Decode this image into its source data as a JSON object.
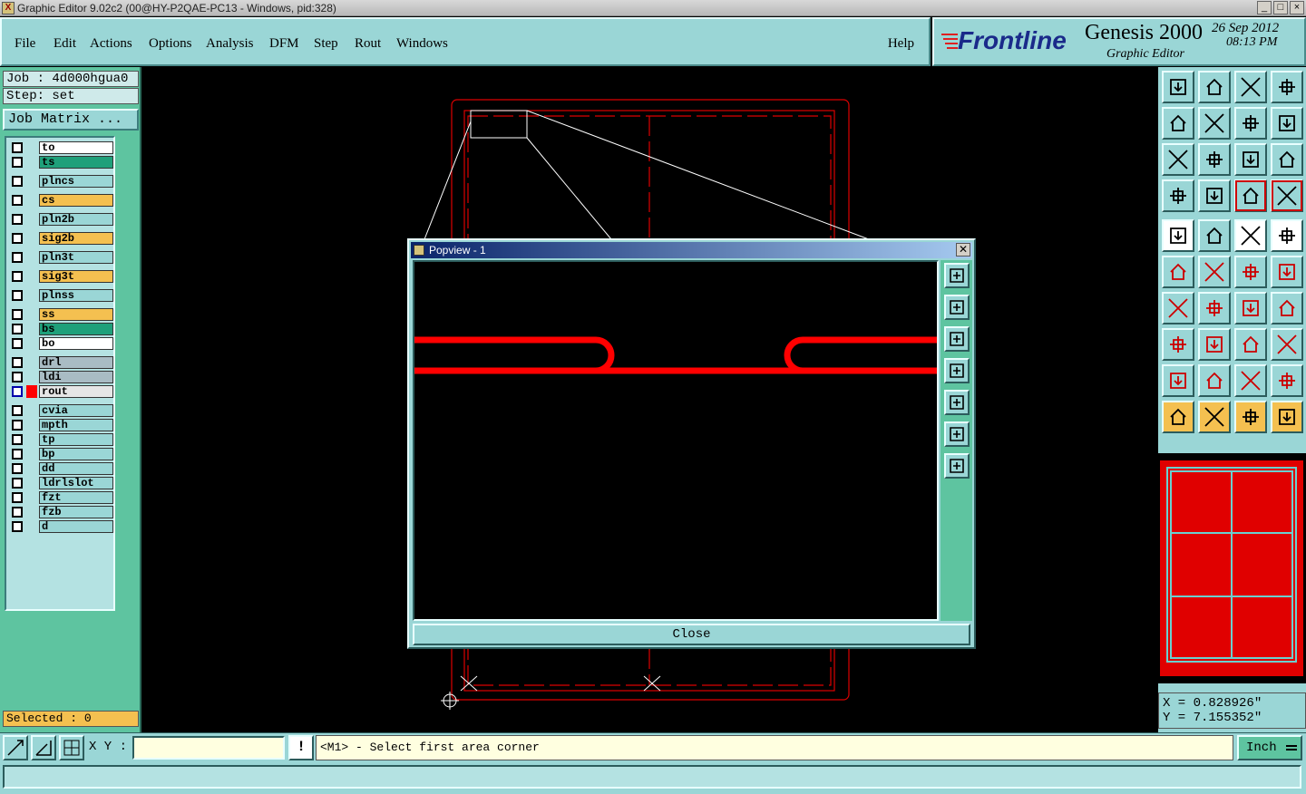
{
  "window": {
    "title": "Graphic Editor 9.02c2 (00@HY-P2QAE-PC13 - Windows, pid:328)",
    "app_icon_glyph": "X"
  },
  "menu": {
    "items": [
      {
        "label": "File",
        "name": "menu-file"
      },
      {
        "label": "Edit",
        "name": "menu-edit"
      },
      {
        "label": "Actions",
        "name": "menu-actions"
      },
      {
        "label": "Options",
        "name": "menu-options"
      },
      {
        "label": "Analysis",
        "name": "menu-analysis"
      },
      {
        "label": "DFM",
        "name": "menu-dfm"
      },
      {
        "label": "Step",
        "name": "menu-step"
      },
      {
        "label": "Rout",
        "name": "menu-rout"
      },
      {
        "label": "Windows",
        "name": "menu-windows"
      }
    ],
    "help_label": "Help"
  },
  "brand": {
    "logo": "Frontline",
    "product": "Genesis 2000",
    "subtitle": "Graphic Editor",
    "date": "26 Sep 2012",
    "time": "08:13 PM"
  },
  "job": {
    "job_label": "Job : 4d000hgua0",
    "step_label": "Step: set",
    "matrix_button": "Job Matrix ..."
  },
  "layers": [
    {
      "name": "to",
      "color": "#ffffff"
    },
    {
      "name": "ts",
      "color": "#1fa07a"
    },
    {
      "name": "plncs",
      "color": "#9ad6d6"
    },
    {
      "name": "cs",
      "color": "#f4c050"
    },
    {
      "name": "pln2b",
      "color": "#9ad6d6"
    },
    {
      "name": "sig2b",
      "color": "#f4c050"
    },
    {
      "name": "pln3t",
      "color": "#9ad6d6"
    },
    {
      "name": "sig3t",
      "color": "#f4c050"
    },
    {
      "name": "plnss",
      "color": "#9ad6d6"
    },
    {
      "name": "ss",
      "color": "#f4c050"
    },
    {
      "name": "bs",
      "color": "#1fa07a"
    },
    {
      "name": "bo",
      "color": "#ffffff"
    },
    {
      "name": "drl",
      "color": "#a9bcc4"
    },
    {
      "name": "ldi",
      "color": "#a9bcc4"
    },
    {
      "name": "rout",
      "color": "#e6e6e6",
      "active": true
    },
    {
      "name": "cvia",
      "color": "#9ad6d6"
    },
    {
      "name": "mpth",
      "color": "#9ad6d6"
    },
    {
      "name": "tp",
      "color": "#9ad6d6"
    },
    {
      "name": "bp",
      "color": "#9ad6d6"
    },
    {
      "name": "dd",
      "color": "#9ad6d6"
    },
    {
      "name": "ldrlslot",
      "color": "#9ad6d6"
    },
    {
      "name": "fzt",
      "color": "#9ad6d6"
    },
    {
      "name": "fzb",
      "color": "#9ad6d6"
    },
    {
      "name": "d",
      "color": "#9ad6d6"
    }
  ],
  "selected_label": "Selected : 0",
  "coords": {
    "x": "X = 0.828926\"",
    "y": "Y = 7.155352\""
  },
  "bottom": {
    "xy_label": "X Y :",
    "xy_input_value": "",
    "prompt": "<M1> - Select first area corner",
    "units": "Inch",
    "alert_glyph": "!"
  },
  "popview": {
    "title": "Popview - 1",
    "close_label": "Close",
    "close_glyph": "✕"
  },
  "colors": {
    "panel": "#9ad6d6",
    "accent_green": "#5ec4a0",
    "rout_red": "#ff0000",
    "highlight_yellow": "#f4c050"
  }
}
